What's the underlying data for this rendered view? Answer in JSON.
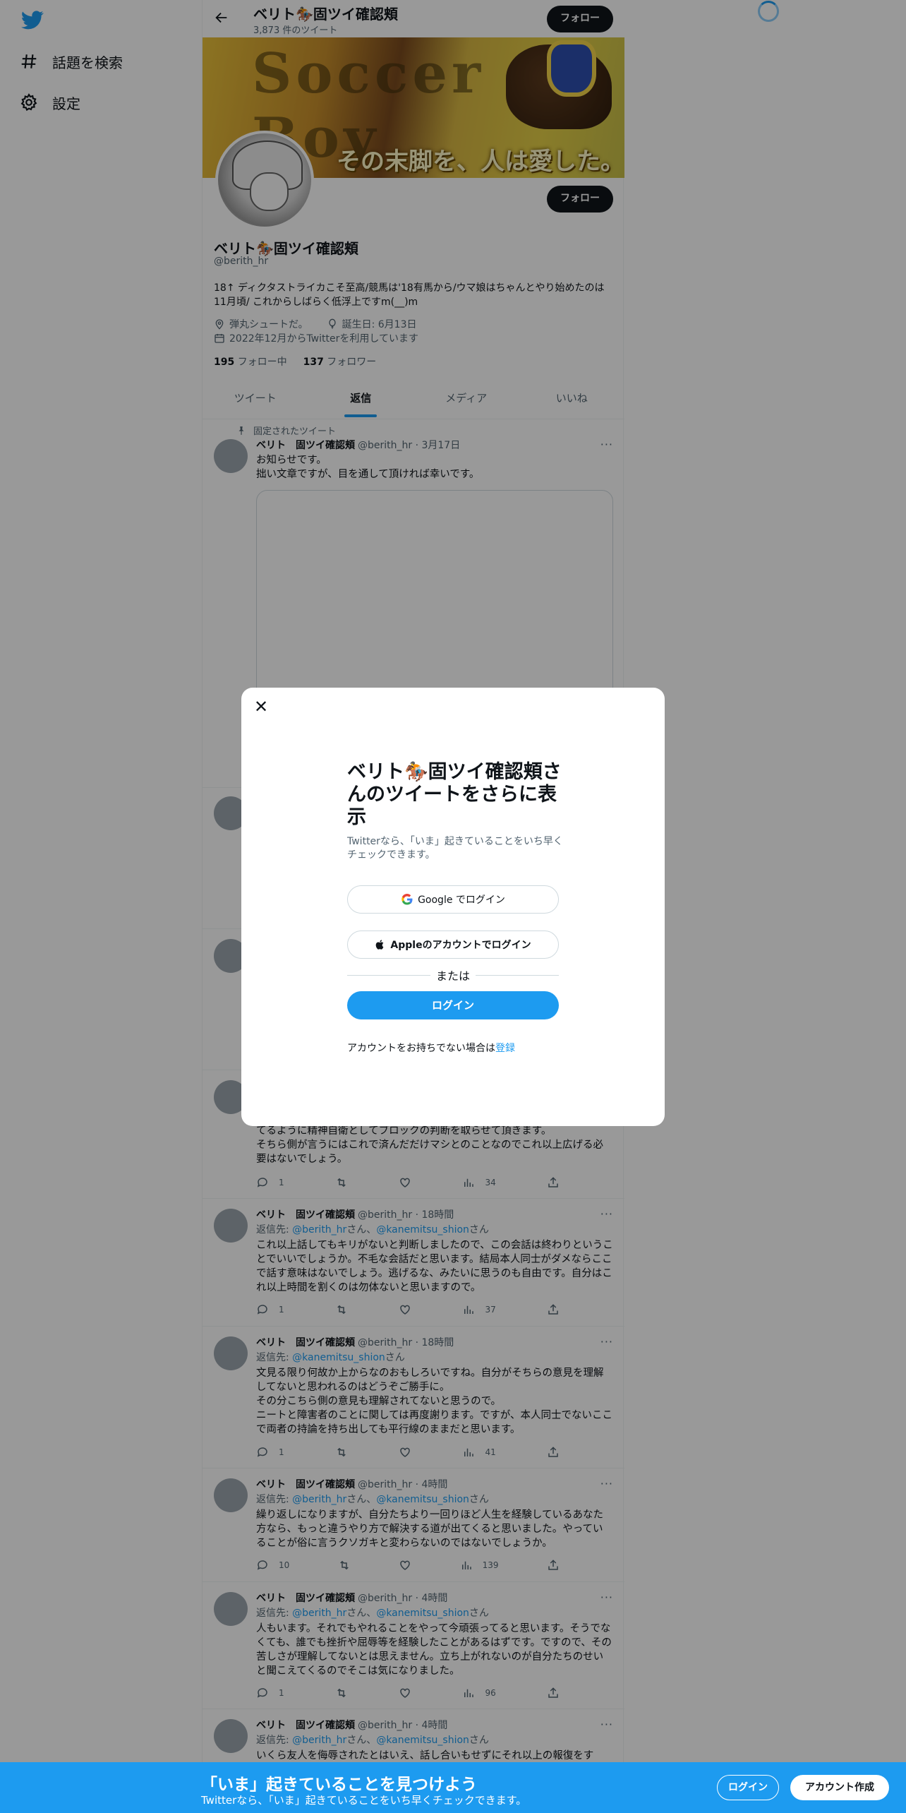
{
  "nav": {
    "explore": "話題を検索",
    "settings": "設定"
  },
  "header": {
    "title": "ベリト🏇固ツイ確認頬",
    "tweet_count": "3,873 件のツイート",
    "follow": "フォロー"
  },
  "profile": {
    "banner_text": "Soccer Boy",
    "banner_tagline": "その末脚を、人は愛した。",
    "name": "ベリト🏇固ツイ確認頬",
    "handle": "@berith_hr",
    "follow": "フォロー",
    "bio": "18↑ ディクタストライカこそ至高/競馬は'18有馬から/ウマ娘はちゃんとやり始めたのは11月頃/ これからしばらく低浮上ですm(__)m",
    "location": "弾丸シュートだ。",
    "birthday": "誕生日: 6月13日",
    "joined": "2022年12月からTwitterを利用しています",
    "following_count": "195",
    "following_label": "フォロー中",
    "followers_count": "137",
    "followers_label": "フォロワー"
  },
  "tabs": [
    "ツイート",
    "返信",
    "メディア",
    "いいね"
  ],
  "pinned": {
    "label": "固定されたツイート",
    "name": "ベリト　固ツイ確認頬",
    "handle_time": "@berith_hr · 3月17日",
    "text1": "お知らせです。",
    "text2": "拙い文章ですが、目を通して頂ければ幸いです。"
  },
  "tweets": [
    {
      "text": "てるように精神自衛としてブロックの判断を取らせて頂きます。\nそちら側が言うにはこれで済んだだけマシとのことなのでこれ以上広げる必要はないでしょう。",
      "replies": "1",
      "views": "34"
    },
    {
      "name": "ベリト　固ツイ確認頬",
      "handle_time": "@berith_hr · 18時間",
      "reply_prefix": "返信先: ",
      "mention1": "@berith_hr",
      "sep": "さん、",
      "mention2": "@kanemitsu_shion",
      "suffix": "さん",
      "text": "これ以上話してもキリがないと判断しましたので、この会話は終わりということでいいでしょうか。不毛な会話だと思います。結局本人同士がダメならここで話す意味はないでしょう。逃げるな、みたいに思うのも自由です。自分はこれ以上時間を割くのは勿体ないと思いますので。",
      "replies": "1",
      "views": "37"
    },
    {
      "name": "ベリト　固ツイ確認頬",
      "handle_time": "@berith_hr · 18時間",
      "reply_prefix": "返信先: ",
      "mention1": "@kanemitsu_shion",
      "suffix": "さん",
      "text": "文見る限り何故か上からなのおもしろいですね。自分がそちらの意見を理解してないと思われるのはどうぞご勝手に。\nその分こちら側の意見も理解されてないと思うので。\nニートと障害者のことに関しては再度謝ります。ですが、本人同士でないここで両者の持論を持ち出しても平行線のままだと思います。",
      "replies": "1",
      "views": "41"
    },
    {
      "name": "ベリト　固ツイ確認頬",
      "handle_time": "@berith_hr · 4時間",
      "reply_prefix": "返信先: ",
      "mention1": "@berith_hr",
      "sep": "さん、",
      "mention2": "@kanemitsu_shion",
      "suffix": "さん",
      "text": "繰り返しになりますが、自分たちより一回りほど人生を経験しているあなた方なら、もっと違うやり方で解決する道が出てくると思いました。やっていることが俗に言うクソガキと変わらないのではないでしょうか。",
      "replies": "10",
      "views": "139"
    },
    {
      "name": "ベリト　固ツイ確認頬",
      "handle_time": "@berith_hr · 4時間",
      "reply_prefix": "返信先: ",
      "mention1": "@berith_hr",
      "sep": "さん、",
      "mention2": "@kanemitsu_shion",
      "suffix": "さん",
      "text": "人もいます。それでもやれることをやって今頑張ってると思います。そうでなくても、誰でも挫折や屈辱等を経験したことがあるはずです。ですので、その苦しさが理解してないとは思えません。立ち上がれないのが自分たちのせいと聞こえてくるのでそこは気になりました。",
      "replies": "1",
      "views": "96"
    },
    {
      "name": "ベリト　固ツイ確認頬",
      "handle_time": "@berith_hr · 4時間",
      "reply_prefix": "返信先: ",
      "mention1": "@berith_hr",
      "sep": "さん、",
      "mention2": "@kanemitsu_shion",
      "suffix": "さん",
      "text": "いくら友人を侮辱されたとはいえ、話し合いもせずにそれ以上の報復をす"
    }
  ],
  "modal": {
    "title": "ベリト🏇固ツイ確認頬さんのツイートをさらに表示",
    "desc": "Twitterなら、「いま」起きていることをいち早くチェックできます。",
    "google": "Google でログイン",
    "apple": "Appleのアカウントでログイン",
    "or": "または",
    "login": "ログイン",
    "signup_text": "アカウントをお持ちでない場合は",
    "signup_link": "登録"
  },
  "bottom_bar": {
    "title": "「いま」起きていることを見つけよう",
    "sub": "Twitterなら、「いま」起きていることをいち早くチェックできます。",
    "login": "ログイン",
    "create": "アカウント作成"
  },
  "colors": {
    "accent": "#1d9bf0",
    "text": "#0f1419",
    "muted": "#536471"
  }
}
